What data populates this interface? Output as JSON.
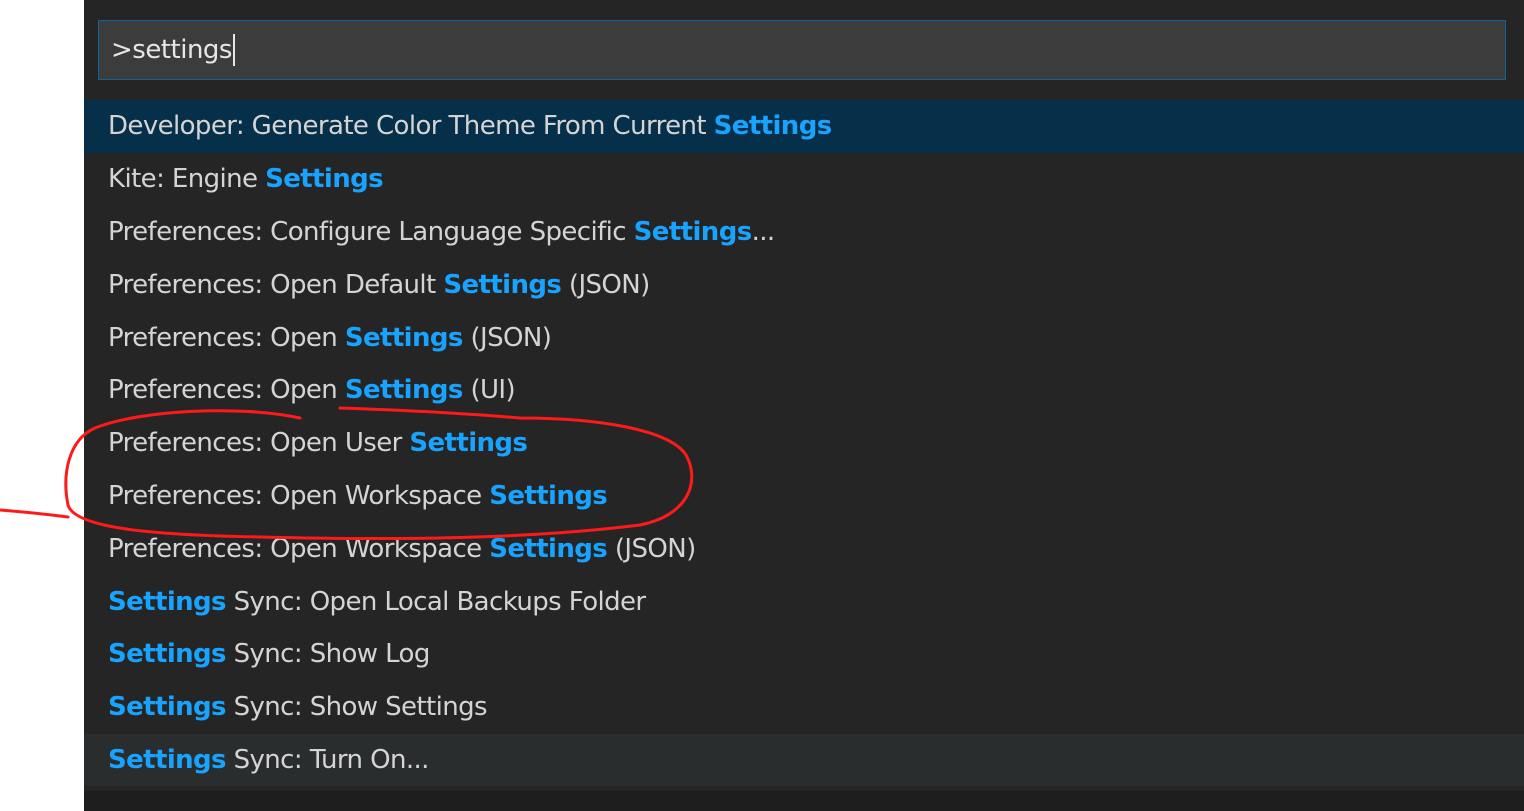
{
  "command_palette": {
    "query": ">settings",
    "results": [
      {
        "before": "Developer: Generate Color Theme From Current ",
        "match": "Settings",
        "after": ""
      },
      {
        "before": "Kite: Engine ",
        "match": "Settings",
        "after": ""
      },
      {
        "before": "Preferences: Configure Language Specific ",
        "match": "Settings",
        "after": "..."
      },
      {
        "before": "Preferences: Open Default ",
        "match": "Settings",
        "after": " (JSON)"
      },
      {
        "before": "Preferences: Open ",
        "match": "Settings",
        "after": " (JSON)"
      },
      {
        "before": "Preferences: Open ",
        "match": "Settings",
        "after": " (UI)"
      },
      {
        "before": "Preferences: Open User ",
        "match": "Settings",
        "after": ""
      },
      {
        "before": "Preferences: Open Workspace ",
        "match": "Settings",
        "after": ""
      },
      {
        "before": "Preferences: Open Workspace ",
        "match": "Settings",
        "after": " (JSON)"
      },
      {
        "before": "",
        "match": "Settings",
        "after": " Sync: Open Local Backups Folder"
      },
      {
        "before": "",
        "match": "Settings",
        "after": " Sync: Show Log"
      },
      {
        "before": "",
        "match": "Settings",
        "after": " Sync: Show Settings"
      },
      {
        "before": "",
        "match": "Settings",
        "after": " Sync: Turn On..."
      }
    ]
  },
  "colors": {
    "highlight": "#18a3ff",
    "annotation": "#ff1a1a"
  }
}
